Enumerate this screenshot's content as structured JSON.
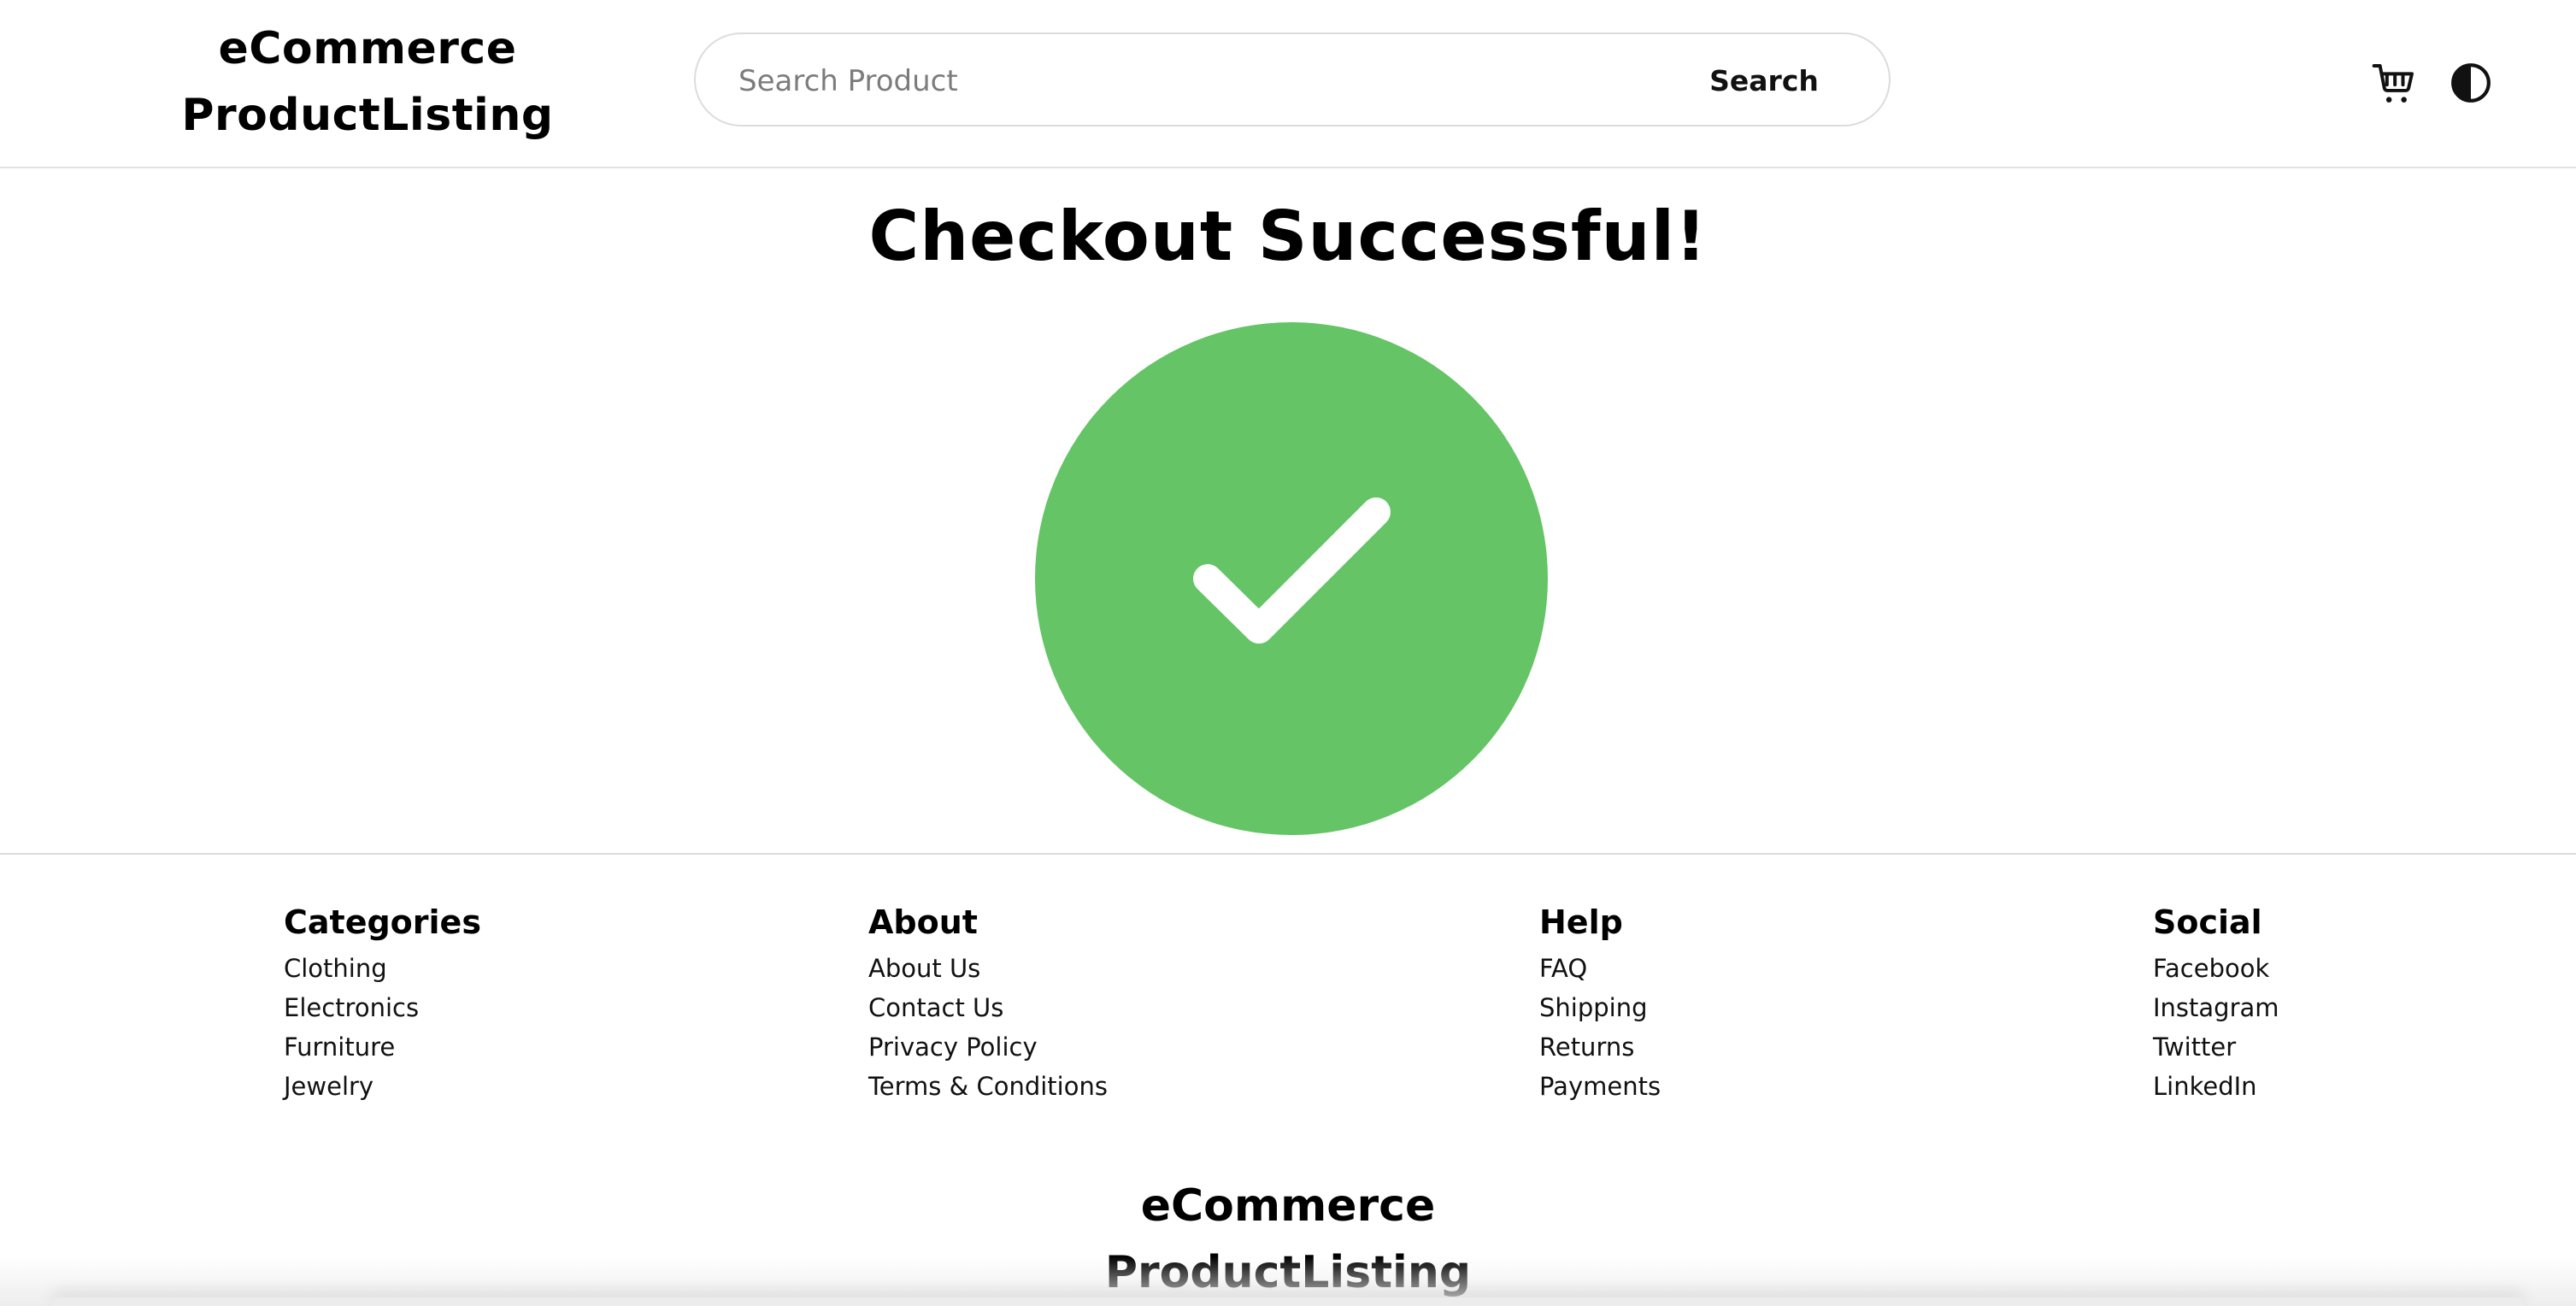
{
  "header": {
    "logo_line1": "eCommerce",
    "logo_line2": "ProductListing",
    "search_placeholder": "Search Product",
    "search_value": "",
    "search_button_label": "Search",
    "cart_icon": "shopping-cart-icon",
    "theme_icon": "theme-toggle-icon"
  },
  "main": {
    "title": "Checkout Successful!",
    "status_icon": "check-circle-icon",
    "status_color": "#64c466"
  },
  "footer": {
    "columns": [
      {
        "title": "Categories",
        "items": [
          "Clothing",
          "Electronics",
          "Furniture",
          "Jewelry"
        ]
      },
      {
        "title": "About",
        "items": [
          "About Us",
          "Contact Us",
          "Privacy Policy",
          "Terms & Conditions"
        ]
      },
      {
        "title": "Help",
        "items": [
          "FAQ",
          "Shipping",
          "Returns",
          "Payments"
        ]
      },
      {
        "title": "Social",
        "items": [
          "Facebook",
          "Instagram",
          "Twitter",
          "LinkedIn"
        ]
      }
    ],
    "logo_line1": "eCommerce",
    "logo_line2": "ProductListing"
  }
}
